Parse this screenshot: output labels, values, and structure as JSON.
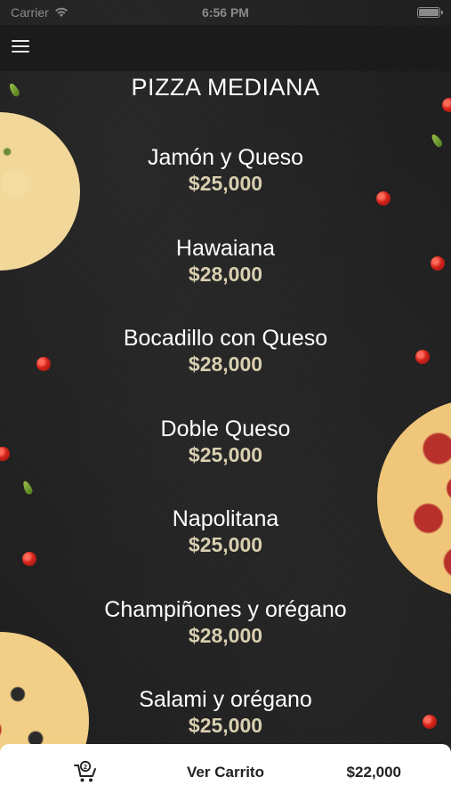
{
  "status_bar": {
    "carrier": "Carrier",
    "time": "6:56 PM"
  },
  "header": {
    "menu_icon": "hamburger-menu-icon",
    "title": "PIZZA MEDIANA"
  },
  "menu": {
    "items": [
      {
        "name": "Jamón y Queso",
        "price": "$25,000"
      },
      {
        "name": "Hawaiana",
        "price": "$28,000"
      },
      {
        "name": "Bocadillo con Queso",
        "price": "$28,000"
      },
      {
        "name": "Doble Queso",
        "price": "$25,000"
      },
      {
        "name": "Napolitana",
        "price": "$25,000"
      },
      {
        "name": "Champiñones y orégano",
        "price": "$28,000"
      },
      {
        "name": "Salami y orégano",
        "price": "$25,000"
      }
    ]
  },
  "cart_bar": {
    "icon": "shopping-cart-icon",
    "label": "Ver Carrito",
    "total": "$22,000"
  },
  "colors": {
    "background": "#1f1f1f",
    "title": "#ffffff",
    "price": "#d9cfb0",
    "cart_bar": "#ffffff"
  }
}
